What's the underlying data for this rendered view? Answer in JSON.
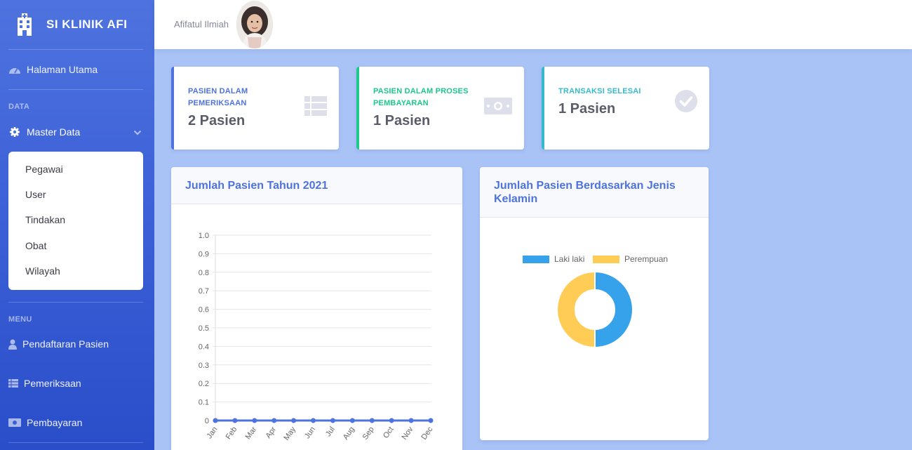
{
  "brand": {
    "name": "SI KLINIK AFI"
  },
  "sidebar": {
    "home": "Halaman Utama",
    "section_data": "DATA",
    "master": "Master Data",
    "submenu": [
      "Pegawai",
      "User",
      "Tindakan",
      "Obat",
      "Wilayah"
    ],
    "section_menu": "MENU",
    "menu": [
      "Pendaftaran Pasien",
      "Pemeriksaan",
      "Pembayaran"
    ]
  },
  "topbar": {
    "user": "Afifatul Ilmiah"
  },
  "stats": [
    {
      "label": "Pasien Dalam Pemeriksaan",
      "value": "2 Pasien",
      "color": "#4e73df",
      "icon": "table-icon"
    },
    {
      "label": "Pasien Dalam Proses Pembayaran",
      "value": "1 Pasien",
      "color": "#1cc88a",
      "icon": "money-icon"
    },
    {
      "label": "Transaksi Selesai",
      "value": "1 Pasien",
      "color": "#36b9cc",
      "icon": "check-circle-icon"
    }
  ],
  "line_panel": {
    "title": "Jumlah Pasien Tahun 2021"
  },
  "pie_panel": {
    "title": "Jumlah Pasien Berdasarkan Jenis Kelamin"
  },
  "chart_data": [
    {
      "type": "line",
      "title": "Jumlah Pasien Tahun 2021",
      "categories": [
        "Jan",
        "Feb",
        "Mar",
        "Apr",
        "May",
        "Jun",
        "Jul",
        "Aug",
        "Sep",
        "Oct",
        "Nov",
        "Dec"
      ],
      "series": [
        {
          "values": [
            0,
            0,
            0,
            0,
            0,
            0,
            0,
            0,
            0,
            0,
            0,
            0
          ],
          "color": "#4e73df"
        }
      ],
      "ylim": [
        0,
        1.0
      ],
      "yticks": [
        "0",
        "0.1",
        "0.2",
        "0.3",
        "0.4",
        "0.5",
        "0.6",
        "0.7",
        "0.8",
        "0.9",
        "1.0"
      ],
      "grid": true
    },
    {
      "type": "pie",
      "variant": "doughnut",
      "title": "Jumlah Pasien Berdasarkan Jenis Kelamin",
      "legend": "top",
      "categories": [
        "Laki laki",
        "Perempuan"
      ],
      "values": [
        1,
        1
      ],
      "colors": [
        "#36a2eb",
        "#ffcd56"
      ]
    }
  ]
}
